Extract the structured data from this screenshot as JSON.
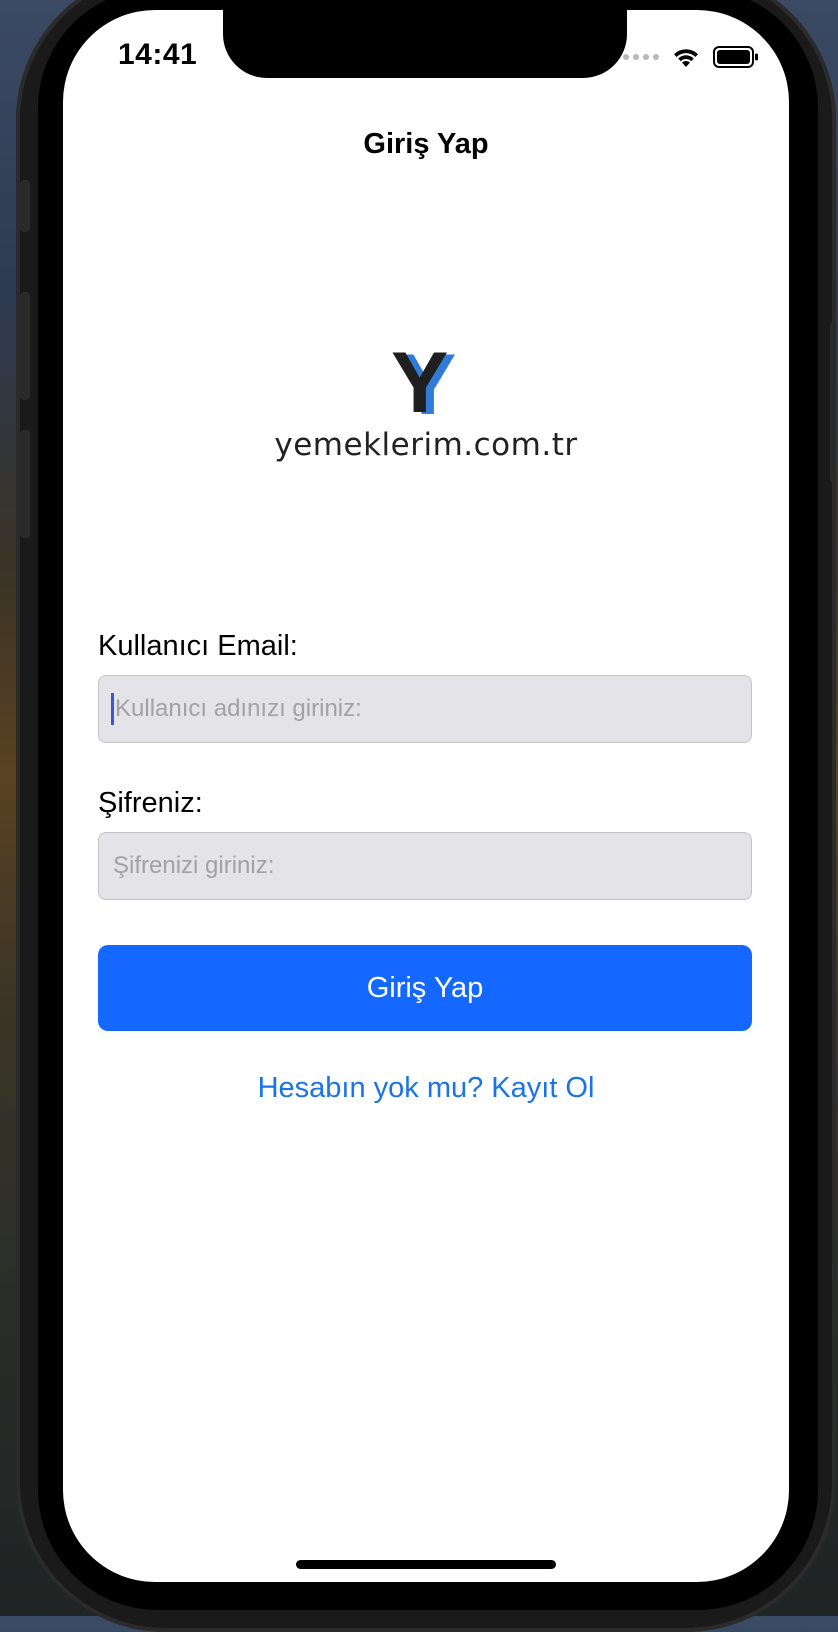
{
  "status_bar": {
    "time": "14:41",
    "icons": [
      "cellular-signal-icon",
      "wifi-icon",
      "battery-icon"
    ]
  },
  "nav": {
    "title": "Giriş Yap"
  },
  "logo": {
    "mark": "Y",
    "text": "yemeklerim.com.tr"
  },
  "form": {
    "email_label": "Kullanıcı Email:",
    "email_value": "",
    "email_placeholder": "Kullanıcı adınızı giriniz:",
    "password_label": "Şifreniz:",
    "password_value": "",
    "password_placeholder": "Şifrenizi giriniz:"
  },
  "actions": {
    "login_label": "Giriş Yap",
    "register_link": "Hesabın yok mu? Kayıt Ol"
  },
  "colors": {
    "accent": "#1468ff",
    "link": "#1a73e8",
    "field_bg": "#e3e3e8",
    "logo_blue": "#2f7bd7"
  }
}
